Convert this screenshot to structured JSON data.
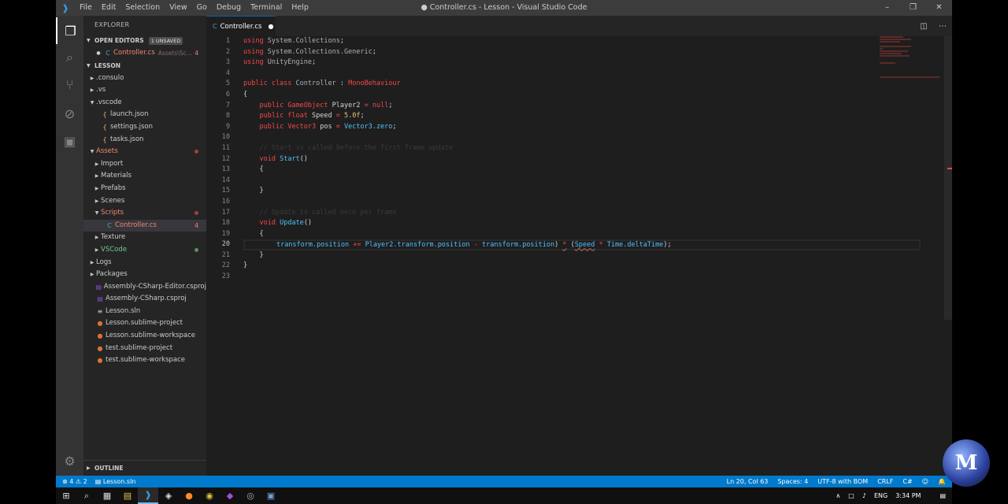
{
  "window": {
    "title": "● Controller.cs - Lesson - Visual Studio Code",
    "menu": [
      "File",
      "Edit",
      "Selection",
      "View",
      "Go",
      "Debug",
      "Terminal",
      "Help"
    ]
  },
  "sidebar": {
    "title": "EXPLORER",
    "open_editors": {
      "label": "OPEN EDITORS",
      "badge": "1 UNSAVED",
      "file": "Controller.cs",
      "path": "Assets\\Sc...",
      "count": "4"
    },
    "project": "LESSON",
    "tree": [
      {
        "label": ".consulo",
        "indent": 1,
        "type": "folder",
        "state": "normal"
      },
      {
        "label": ".vs",
        "indent": 1,
        "type": "folder",
        "state": "normal"
      },
      {
        "label": ".vscode",
        "indent": 1,
        "type": "folder-open",
        "state": "normal"
      },
      {
        "label": "launch.json",
        "indent": 2,
        "type": "json",
        "state": "normal"
      },
      {
        "label": "settings.json",
        "indent": 2,
        "type": "json",
        "state": "normal"
      },
      {
        "label": "tasks.json",
        "indent": 2,
        "type": "json",
        "state": "normal"
      },
      {
        "label": "Assets",
        "indent": 1,
        "type": "folder-open",
        "state": "err",
        "marker": "dot"
      },
      {
        "label": "Import",
        "indent": 2,
        "type": "folder",
        "state": "normal"
      },
      {
        "label": "Materials",
        "indent": 2,
        "type": "folder",
        "state": "normal"
      },
      {
        "label": "Prefabs",
        "indent": 2,
        "type": "folder",
        "state": "normal"
      },
      {
        "label": "Scenes",
        "indent": 2,
        "type": "folder",
        "state": "normal"
      },
      {
        "label": "Scripts",
        "indent": 2,
        "type": "folder-open",
        "state": "err",
        "marker": "dot"
      },
      {
        "label": "Controller.cs",
        "indent": 3,
        "type": "cs",
        "state": "err",
        "marker": "4",
        "selected": true
      },
      {
        "label": "Texture",
        "indent": 2,
        "type": "folder",
        "state": "normal"
      },
      {
        "label": "VSCode",
        "indent": 2,
        "type": "folder",
        "state": "mod",
        "marker": "dot-green"
      },
      {
        "label": "Logs",
        "indent": 1,
        "type": "folder",
        "state": "normal"
      },
      {
        "label": "Packages",
        "indent": 1,
        "type": "folder",
        "state": "normal"
      },
      {
        "label": "Assembly-CSharp-Editor.csproj",
        "indent": 1,
        "type": "proj",
        "state": "normal"
      },
      {
        "label": "Assembly-CSharp.csproj",
        "indent": 1,
        "type": "proj",
        "state": "normal"
      },
      {
        "label": "Lesson.sln",
        "indent": 1,
        "type": "sln",
        "state": "normal"
      },
      {
        "label": "Lesson.sublime-project",
        "indent": 1,
        "type": "sublime",
        "state": "normal"
      },
      {
        "label": "Lesson.sublime-workspace",
        "indent": 1,
        "type": "sublime",
        "state": "normal"
      },
      {
        "label": "test.sublime-project",
        "indent": 1,
        "type": "sublime",
        "state": "normal"
      },
      {
        "label": "test.sublime-workspace",
        "indent": 1,
        "type": "sublime",
        "state": "normal"
      }
    ],
    "outline": "OUTLINE"
  },
  "tab": {
    "label": "Controller.cs"
  },
  "editor": {
    "line_numbers": [
      "1",
      "2",
      "3",
      "4",
      "5",
      "6",
      "7",
      "8",
      "9",
      "10",
      "11",
      "12",
      "13",
      "14",
      "15",
      "16",
      "17",
      "18",
      "19",
      "20",
      "21",
      "22",
      "23"
    ],
    "active_line": 20
  },
  "statusbar": {
    "errors": "4",
    "warnings": "2",
    "solution": "Lesson.sln",
    "position": "Ln 20, Col 63",
    "spaces": "Spaces: 4",
    "encoding": "UTF-8 with BOM",
    "eol": "CRLF",
    "language": "C#"
  },
  "taskbar": {
    "lang": "ENG",
    "time": "3:34 PM"
  },
  "icons": {
    "explorer": "files-icon",
    "search": "search-icon",
    "scm": "source-control-icon",
    "debug": "debug-icon",
    "extensions": "extensions-icon",
    "settings": "gear-icon"
  }
}
